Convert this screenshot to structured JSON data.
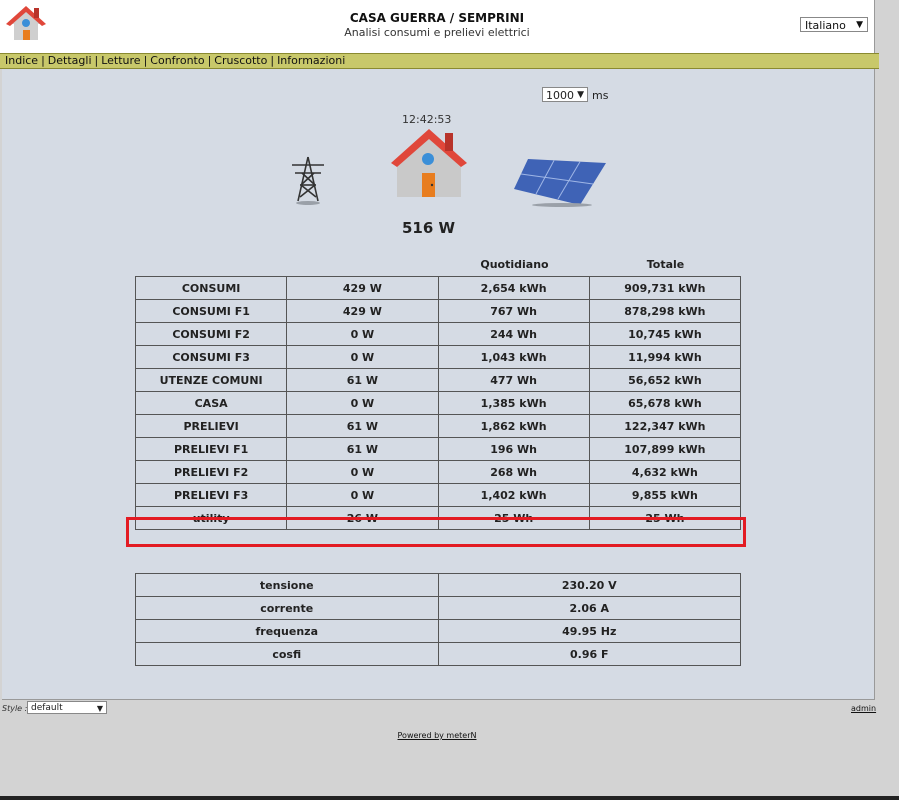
{
  "header": {
    "title": "CASA GUERRA / SEMPRINI",
    "subtitle": "Analisi consumi e prelievi elettrici",
    "language": "Italiano"
  },
  "menu": [
    "Indice",
    "Dettagli",
    "Letture",
    "Confronto",
    "Cruscotto",
    "Informazioni"
  ],
  "live": {
    "refresh_value": "1000",
    "refresh_unit": "ms",
    "time": "12:42:53",
    "power": "516 W",
    "icons": [
      "power-pylon-icon",
      "house-icon",
      "solar-panel-icon"
    ]
  },
  "energy_table": {
    "headers": [
      "",
      "",
      "Quotidiano",
      "Totale"
    ],
    "rows": [
      [
        "CONSUMI",
        "429 W",
        "2,654 kWh",
        "909,731 kWh"
      ],
      [
        "CONSUMI F1",
        "429 W",
        "767 Wh",
        "878,298 kWh"
      ],
      [
        "CONSUMI F2",
        "0 W",
        "244 Wh",
        "10,745 kWh"
      ],
      [
        "CONSUMI F3",
        "0 W",
        "1,043 kWh",
        "11,994 kWh"
      ],
      [
        "UTENZE COMUNI",
        "61 W",
        "477 Wh",
        "56,652 kWh"
      ],
      [
        "CASA",
        "0 W",
        "1,385 kWh",
        "65,678 kWh"
      ],
      [
        "PRELIEVI",
        "61 W",
        "1,862 kWh",
        "122,347 kWh"
      ],
      [
        "PRELIEVI F1",
        "61 W",
        "196 Wh",
        "107,899 kWh"
      ],
      [
        "PRELIEVI F2",
        "0 W",
        "268 Wh",
        "4,632 kWh"
      ],
      [
        "PRELIEVI F3",
        "0 W",
        "1,402 kWh",
        "9,855 kWh"
      ],
      [
        "utility",
        "26 W",
        "25 Wh",
        "25 Wh"
      ]
    ]
  },
  "grid_table": {
    "rows": [
      [
        "tensione",
        "230.20 V"
      ],
      [
        "corrente",
        "2.06 A"
      ],
      [
        "frequenza",
        "49.95 Hz"
      ],
      [
        "cosfi",
        "0.96 F"
      ]
    ]
  },
  "footer": {
    "style_label": "Style :",
    "style_value": "default",
    "admin": "admin",
    "powered": "Powered by meterN"
  },
  "colors": {
    "menubar": "#c8c86a",
    "content_bg": "#d5dbe4",
    "highlight": "#e31b23",
    "roof": "#e0473a",
    "wall": "#c9c9c9",
    "door": "#e87d1e"
  }
}
